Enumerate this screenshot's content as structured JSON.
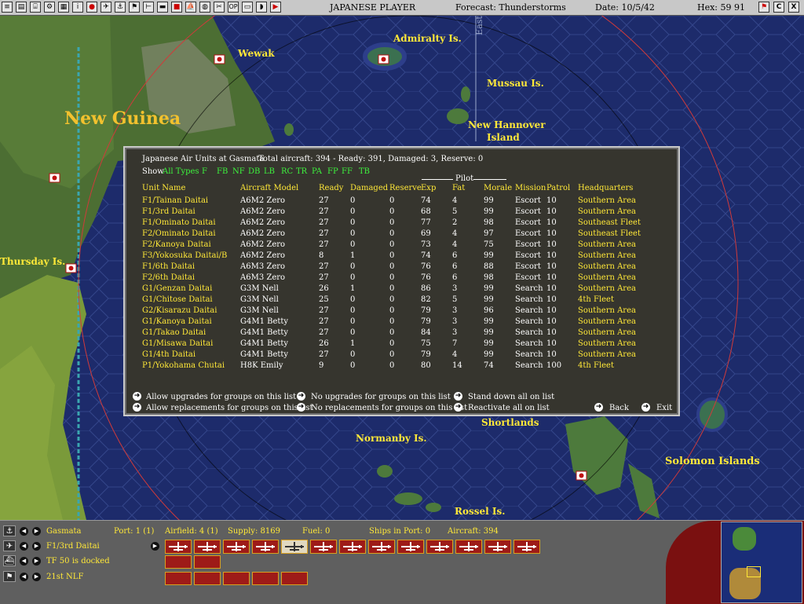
{
  "topbar": {
    "buttons": [
      "menu",
      "save",
      "reports",
      "settings",
      "info",
      "air",
      "naval",
      "lrcap",
      "flag",
      "ground",
      "bomb",
      "ops",
      "recon",
      "globe",
      "op",
      "intel",
      "sub",
      "end"
    ],
    "player": "JAPANESE PLAYER",
    "forecast": "Forecast: Thunderstorms",
    "date": "Date: 10/5/42",
    "hex": "Hex: 59 91",
    "right_icons": [
      "flag-icon",
      "C",
      "X"
    ]
  },
  "map": {
    "labels": {
      "wewak": "Wewak",
      "admiralty": "Admiralty Is.",
      "east": "East",
      "mussau": "Mussau Is.",
      "new_hannover": "New Hannover",
      "island": "Island",
      "new_guinea": "New Guinea",
      "thursday": "Thursday Is.",
      "shortlands": "Shortlands",
      "normanby": "Normanby Is.",
      "solomon": "Solomon Islands",
      "rossel": "Rossel Is."
    },
    "colors": {
      "ocean": "#1d2b6b",
      "land": "#3f6a2e",
      "hex_line": "#3b4e8c",
      "yellow_label": "#ffe838"
    }
  },
  "panel": {
    "title": "Japanese Air Units at Gasmata",
    "totals": "Total aircraft: 394 - Ready: 391, Damaged: 3, Reserve: 0",
    "show_label": "Show",
    "filters": [
      "All Types",
      "F",
      "FB",
      "NF",
      "DB",
      "LB",
      "RC",
      "TR",
      "PA",
      "FP",
      "FF",
      "TB"
    ],
    "pilot_header": "Pilot",
    "columns": [
      "Unit Name",
      "Aircraft Model",
      "Ready",
      "Damaged",
      "Reserve",
      "Exp",
      "Fat",
      "Morale",
      "Mission",
      "Patrol",
      "Headquarters"
    ],
    "rows": [
      [
        "F1/Tainan Daitai",
        "A6M2 Zero",
        "27",
        "0",
        "0",
        "74",
        "4",
        "99",
        "Escort",
        "10",
        "Southern Area"
      ],
      [
        "F1/3rd Daitai",
        "A6M2 Zero",
        "27",
        "0",
        "0",
        "68",
        "5",
        "99",
        "Escort",
        "10",
        "Southern Area"
      ],
      [
        "F1/Ominato Daitai",
        "A6M2 Zero",
        "27",
        "0",
        "0",
        "77",
        "2",
        "98",
        "Escort",
        "10",
        "Southeast Fleet"
      ],
      [
        "F2/Ominato Daitai",
        "A6M2 Zero",
        "27",
        "0",
        "0",
        "69",
        "4",
        "97",
        "Escort",
        "10",
        "Southeast Fleet"
      ],
      [
        "F2/Kanoya Daitai",
        "A6M2 Zero",
        "27",
        "0",
        "0",
        "73",
        "4",
        "75",
        "Escort",
        "10",
        "Southern Area"
      ],
      [
        "F3/Yokosuka Daitai/B",
        "A6M2 Zero",
        "8",
        "1",
        "0",
        "74",
        "6",
        "99",
        "Escort",
        "10",
        "Southern Area"
      ],
      [
        "F1/6th Daitai",
        "A6M3 Zero",
        "27",
        "0",
        "0",
        "76",
        "6",
        "88",
        "Escort",
        "10",
        "Southern Area"
      ],
      [
        "F2/6th Daitai",
        "A6M3 Zero",
        "27",
        "0",
        "0",
        "76",
        "6",
        "98",
        "Escort",
        "10",
        "Southern Area"
      ],
      [
        "G1/Genzan Daitai",
        "G3M Nell",
        "26",
        "1",
        "0",
        "86",
        "3",
        "99",
        "Search",
        "10",
        "Southern Area"
      ],
      [
        "G1/Chitose Daitai",
        "G3M Nell",
        "25",
        "0",
        "0",
        "82",
        "5",
        "99",
        "Search",
        "10",
        "4th Fleet"
      ],
      [
        "G2/Kisarazu Daitai",
        "G3M Nell",
        "27",
        "0",
        "0",
        "79",
        "3",
        "96",
        "Search",
        "10",
        "Southern Area"
      ],
      [
        "G1/Kanoya Daitai",
        "G4M1 Betty",
        "27",
        "0",
        "0",
        "79",
        "3",
        "99",
        "Search",
        "10",
        "Southern Area"
      ],
      [
        "G1/Takao Daitai",
        "G4M1 Betty",
        "27",
        "0",
        "0",
        "84",
        "3",
        "99",
        "Search",
        "10",
        "Southern Area"
      ],
      [
        "G1/Misawa Daitai",
        "G4M1 Betty",
        "26",
        "1",
        "0",
        "75",
        "7",
        "99",
        "Search",
        "10",
        "Southern Area"
      ],
      [
        "G1/4th Daitai",
        "G4M1 Betty",
        "27",
        "0",
        "0",
        "79",
        "4",
        "99",
        "Search",
        "10",
        "Southern Area"
      ],
      [
        "P1/Yokohama Chutai",
        "H8K Emily",
        "9",
        "0",
        "0",
        "80",
        "14",
        "74",
        "Search",
        "100",
        "4th Fleet"
      ]
    ],
    "actions": {
      "allow_upgrades": "Allow upgrades for groups on this list",
      "allow_replacements": "Allow replacements for groups on this list",
      "no_upgrades": "No upgrades for groups on this list",
      "no_replacements": "No replacements for groups on this list",
      "stand_down": "Stand down all on list",
      "reactivate": "Reactivate all on list",
      "back": "Back",
      "exit": "Exit"
    }
  },
  "bottombar": {
    "base": "Gasmata",
    "port": "Port: 1 (1)",
    "airfield": "Airfield: 4 (1)",
    "supply": "Supply: 8169",
    "fuel": "Fuel: 0",
    "ships_in_port": "Ships in Port: 0",
    "aircraft": "Aircraft: 394",
    "unit": "F1/3rd Daitai",
    "tf": "TF 50 is docked",
    "ground": "21st NLF"
  }
}
